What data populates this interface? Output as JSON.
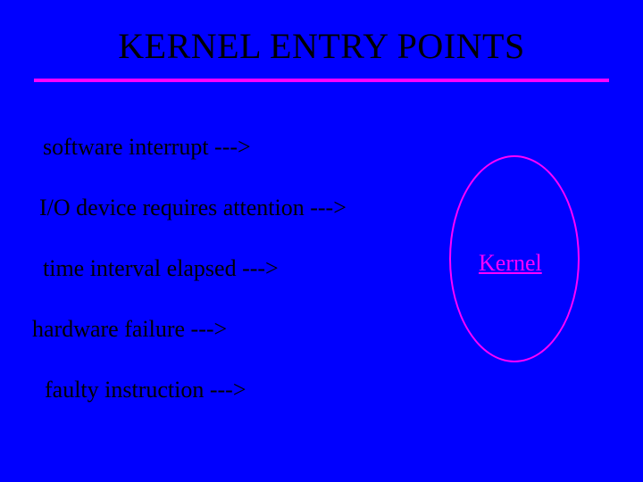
{
  "title": "KERNEL ENTRY POINTS",
  "items": [
    "software interrupt --->",
    "I/O device requires attention --->",
    "time interval elapsed --->",
    "hardware failure --->",
    "faulty instruction --->"
  ],
  "kernel_label": "Kernel",
  "colors": {
    "background": "#0000ff",
    "title_text": "#000000",
    "body_text": "#000000",
    "accent": "#ff00ff"
  }
}
